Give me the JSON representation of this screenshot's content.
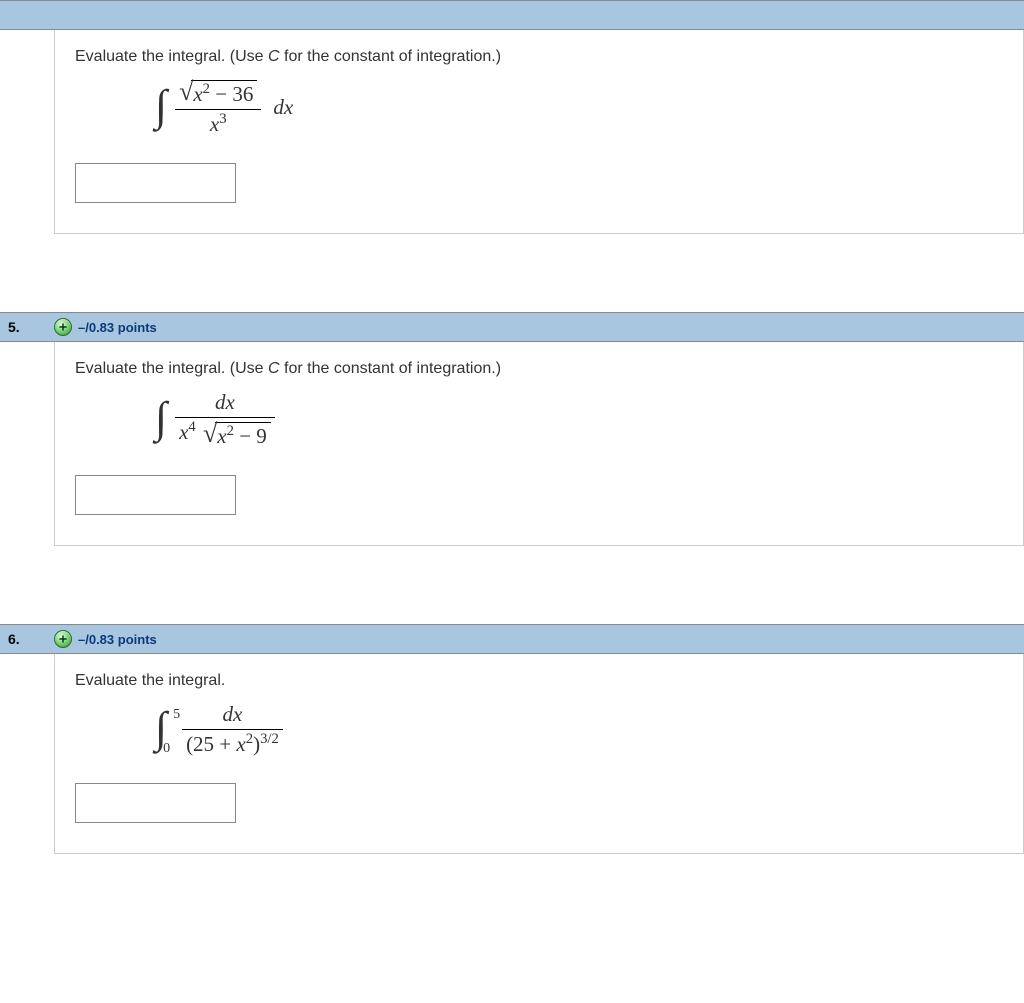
{
  "questions": [
    {
      "number": "",
      "points": "",
      "prompt_html": "Evaluate the integral. (Use <i>C</i> for the constant of integration.)",
      "formula_key": "f4"
    },
    {
      "number": "5.",
      "points": "–/0.83 points",
      "prompt_html": "Evaluate the integral. (Use <i>C</i> for the constant of integration.)",
      "formula_key": "f5"
    },
    {
      "number": "6.",
      "points": "–/0.83 points",
      "prompt_html": "Evaluate the integral.",
      "formula_key": "f6"
    }
  ],
  "formulas": {
    "f4": {
      "latex": "\\int \\frac{\\sqrt{x^2 - 36}}{x^3}\\,dx",
      "numerator_radicand": "x² − 36",
      "denominator": "x³",
      "trailing": "dx"
    },
    "f5": {
      "latex": "\\int \\frac{dx}{x^4 \\sqrt{x^2 - 9}}",
      "numerator": "dx",
      "denom_left": "x⁴",
      "denom_radicand": "x² − 9"
    },
    "f6": {
      "latex": "\\int_0^5 \\frac{dx}{(25 + x^2)^{3/2}}",
      "upper": "5",
      "lower": "0",
      "numerator": "dx",
      "denom": "(25 + x²)",
      "denom_exp": "3/2"
    }
  }
}
